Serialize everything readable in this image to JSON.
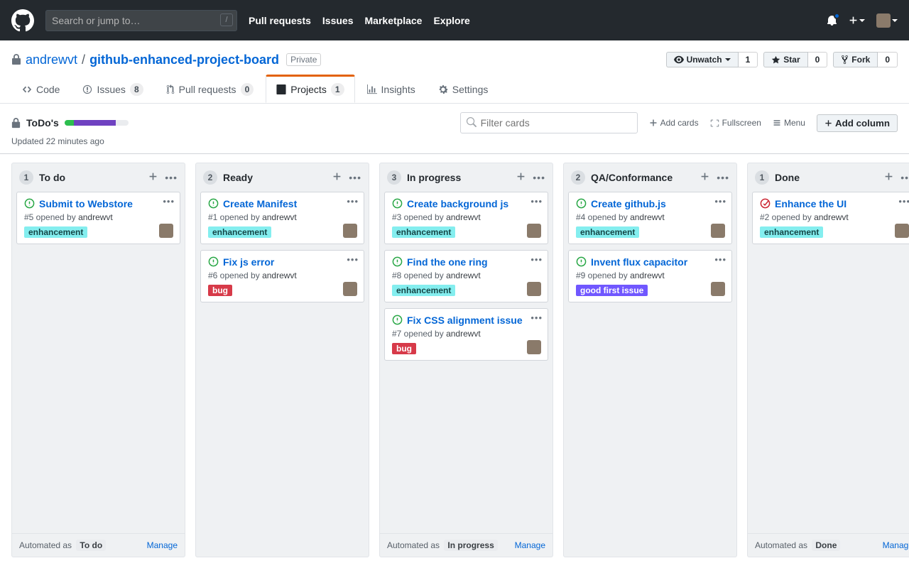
{
  "header": {
    "search_placeholder": "Search or jump to…",
    "nav": [
      "Pull requests",
      "Issues",
      "Marketplace",
      "Explore"
    ]
  },
  "repo": {
    "owner": "andrewvt",
    "name": "github-enhanced-project-board",
    "visibility": "Private",
    "actions": {
      "watch": {
        "label": "Unwatch",
        "count": "1"
      },
      "star": {
        "label": "Star",
        "count": "0"
      },
      "fork": {
        "label": "Fork",
        "count": "0"
      }
    },
    "tabs": {
      "code": "Code",
      "issues": {
        "label": "Issues",
        "count": "8"
      },
      "pulls": {
        "label": "Pull requests",
        "count": "0"
      },
      "projects": {
        "label": "Projects",
        "count": "1"
      },
      "insights": "Insights",
      "settings": "Settings"
    }
  },
  "board": {
    "name": "ToDo's",
    "updated": "Updated 22 minutes ago",
    "filter_placeholder": "Filter cards",
    "toolbar": {
      "add_cards": "Add cards",
      "fullscreen": "Fullscreen",
      "menu": "Menu",
      "add_column": "Add column"
    },
    "footer": {
      "automated_prefix": "Automated as",
      "manage": "Manage",
      "todo_status": "To do",
      "inprogress_status": "In progress",
      "done_status": "Done"
    }
  },
  "columns": [
    {
      "count": "1",
      "title": "To do",
      "cards": [
        {
          "title": "Submit to Webstore",
          "issue": "#5",
          "author": "andrewvt",
          "labels": [
            "enhancement"
          ],
          "open": true,
          "closed": false
        }
      ],
      "automation": "To do"
    },
    {
      "count": "2",
      "title": "Ready",
      "cards": [
        {
          "title": "Create Manifest",
          "issue": "#1",
          "author": "andrewvt",
          "labels": [
            "enhancement"
          ],
          "open": true,
          "closed": false
        },
        {
          "title": "Fix js error",
          "issue": "#6",
          "author": "andrewvt",
          "labels": [
            "bug"
          ],
          "open": true,
          "closed": false
        }
      ],
      "automation": null
    },
    {
      "count": "3",
      "title": "In progress",
      "cards": [
        {
          "title": "Create background js",
          "issue": "#3",
          "author": "andrewvt",
          "labels": [
            "enhancement"
          ],
          "open": true,
          "closed": false
        },
        {
          "title": "Find the one ring",
          "issue": "#8",
          "author": "andrewvt",
          "labels": [
            "enhancement"
          ],
          "open": true,
          "closed": false
        },
        {
          "title": "Fix CSS alignment issue",
          "issue": "#7",
          "author": "andrewvt",
          "labels": [
            "bug"
          ],
          "open": true,
          "closed": false
        }
      ],
      "automation": "In progress"
    },
    {
      "count": "2",
      "title": "QA/Conformance",
      "cards": [
        {
          "title": "Create github.js",
          "issue": "#4",
          "author": "andrewvt",
          "labels": [
            "enhancement"
          ],
          "open": true,
          "closed": false
        },
        {
          "title": "Invent flux capacitor",
          "issue": "#9",
          "author": "andrewvt",
          "labels": [
            "good first issue"
          ],
          "open": true,
          "closed": false
        }
      ],
      "automation": null
    },
    {
      "count": "1",
      "title": "Done",
      "cards": [
        {
          "title": "Enhance the UI",
          "issue": "#2",
          "author": "andrewvt",
          "labels": [
            "enhancement"
          ],
          "open": false,
          "closed": true
        }
      ],
      "automation": "Done"
    }
  ],
  "label_classes": {
    "enhancement": "enhancement",
    "bug": "bug",
    "good first issue": "good-first"
  }
}
